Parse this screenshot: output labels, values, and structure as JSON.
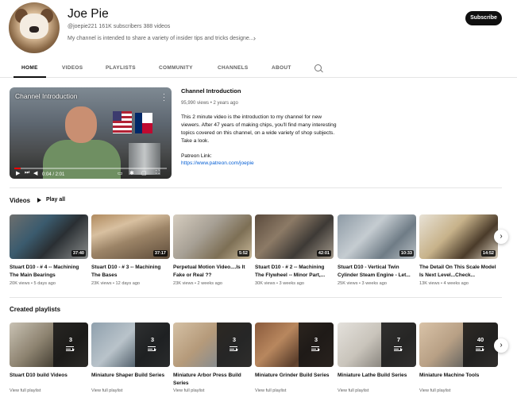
{
  "channel": {
    "name": "Joe Pie",
    "meta": "@joepie221  161K subscribers  388 videos",
    "description": "My channel is intended to share a variety of insider tips and tricks designe...",
    "subscribe_label": "Subscribe"
  },
  "tabs": [
    "HOME",
    "VIDEOS",
    "PLAYLISTS",
    "COMMUNITY",
    "CHANNELS",
    "ABOUT"
  ],
  "featured": {
    "player_title": "Channel Introduction",
    "time": "0:04 / 2:01",
    "title": "Channel Introduction",
    "meta": "95,990 views • 2 years ago",
    "description": "This 2 minute video is the introduction to my channel for new viewers. After 47 years of making chips, you'll find many interesting topics covered on this channel, on a wide variety of shop subjects.  Take a look.",
    "patreon_label": "Patreon Link:",
    "patreon_url": "https://www.patreon.com/joepie"
  },
  "videos_section": {
    "title": "Videos",
    "play_all": "Play all",
    "items": [
      {
        "title": "Stuart D10 - # 4 -- Machining The Main Bearings",
        "meta": "20K views • 5 days ago",
        "duration": "37:40"
      },
      {
        "title": "Stuart D10 - # 3 -- Machining The Bases",
        "meta": "23K views • 12 days ago",
        "duration": "37:17"
      },
      {
        "title": "Perpetual Motion Video....Is It Fake or Real ??",
        "meta": "23K views • 2 weeks ago",
        "duration": "5:52"
      },
      {
        "title": "Stuart D10 - # 2 -- Machining The Flywheel -- Minor Part,...",
        "meta": "30K views • 3 weeks ago",
        "duration": "42:01"
      },
      {
        "title": "Stuart D10 - Vertical Twin Cylinder Steam Engine - Let...",
        "meta": "25K views • 3 weeks ago",
        "duration": "10:33"
      },
      {
        "title": "The Detail On This Scale Model Is Next Level...Check...",
        "meta": "13K views • 4 weeks ago",
        "duration": "14:52"
      }
    ]
  },
  "playlists_section": {
    "title": "Created playlists",
    "items": [
      {
        "title": "Stuart D10 build Videos",
        "count": "3",
        "link": "View full playlist"
      },
      {
        "title": "Miniature Shaper Build Series",
        "count": "3",
        "link": "View full playlist"
      },
      {
        "title": "Miniature Arbor Press Build Series",
        "count": "3",
        "link": "View full playlist"
      },
      {
        "title": "Miniature Grinder Build Series",
        "count": "3",
        "link": "View full playlist"
      },
      {
        "title": "Miniature Lathe Build Series",
        "count": "7",
        "link": "View full playlist"
      },
      {
        "title": "Miniature Machine Tools",
        "count": "40",
        "link": "View full playlist"
      }
    ]
  },
  "icons": {
    "next": "chevron-right-icon",
    "search": "search-icon",
    "more": "more-vert-icon"
  },
  "colors": {
    "accent": "#0f0f0f",
    "link": "#065fd4",
    "progress": "#ff0000"
  }
}
